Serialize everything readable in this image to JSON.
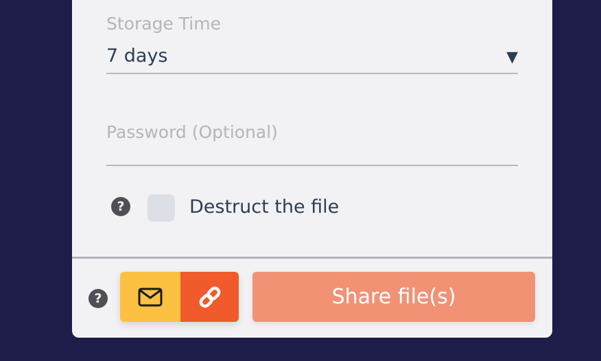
{
  "form": {
    "storage_time": {
      "label": "Storage Time",
      "value": "7 days",
      "arrow": "▼"
    },
    "password": {
      "placeholder": "Password (Optional)",
      "value": ""
    },
    "destruct": {
      "help_glyph": "?",
      "label": "Destruct the file",
      "checked": false
    }
  },
  "actions": {
    "help_glyph": "?",
    "email_icon": "envelope-icon",
    "link_icon": "link-icon",
    "share_label": "Share file(s)"
  },
  "colors": {
    "background": "#1e1d49",
    "card": "#f2f2f5",
    "email_button": "#fcc140",
    "link_button": "#f15a2b",
    "share_button": "#f19275",
    "text": "#2d3e52"
  }
}
